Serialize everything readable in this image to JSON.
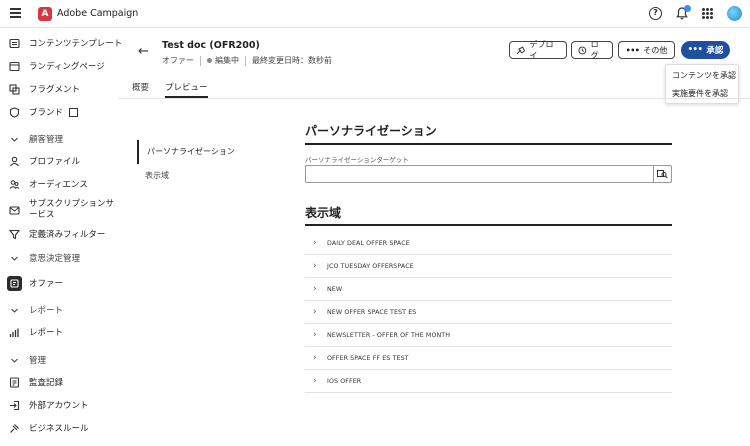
{
  "app": {
    "brand": "Adobe Campaign",
    "logo_letter": "A"
  },
  "sidebar": {
    "items": [
      {
        "label": "コンテンツテンプレート",
        "icon": "template-icon"
      },
      {
        "label": "ランディングページ",
        "icon": "landing-page-icon"
      },
      {
        "label": "フラグメント",
        "icon": "fragment-icon"
      },
      {
        "label": "ブランド",
        "icon": "brand-icon"
      },
      {
        "label": "顧客管理",
        "icon": "chevron-down-icon"
      },
      {
        "label": "プロファイル",
        "icon": "profile-icon"
      },
      {
        "label": "オーディエンス",
        "icon": "audience-icon"
      },
      {
        "label": "サブスクリプションサービス",
        "icon": "subscription-icon"
      },
      {
        "label": "定義済みフィルター",
        "icon": "filter-icon"
      },
      {
        "label": "意思決定管理",
        "icon": "chevron-down-icon"
      },
      {
        "label": "オファー",
        "icon": "offer-icon"
      },
      {
        "label": "レポート",
        "icon": "chevron-down-icon"
      },
      {
        "label": "レポート",
        "icon": "report-icon"
      },
      {
        "label": "管理",
        "icon": "chevron-down-icon"
      },
      {
        "label": "監査記録",
        "icon": "audit-icon"
      },
      {
        "label": "外部アカウント",
        "icon": "external-account-icon"
      },
      {
        "label": "ビジネスルール",
        "icon": "business-rule-icon"
      }
    ]
  },
  "header": {
    "title": "Test doc (OFR200)",
    "type": "オファー",
    "status": "編集中",
    "modified": "最終変更日時：数秒前"
  },
  "toolbar": {
    "deploy": "デプロイ",
    "log": "ログ",
    "more": "その他",
    "approve": "承認"
  },
  "dropdown": {
    "items": [
      "コンテンツを承認",
      "実施要件を承認"
    ]
  },
  "tabs": [
    "概要",
    "プレビュー"
  ],
  "subnav": [
    "パーソナライゼーション",
    "表示域"
  ],
  "personalization": {
    "title": "パーソナライゼーション",
    "field_label": "パーソナライゼーションターゲット",
    "field_value": ""
  },
  "placements": {
    "title": "表示域",
    "items": [
      "DAILY DEAL OFFER SPACE",
      "JCO TUESDAY OFFERSPACE",
      "NEW",
      "NEW OFFER SPACE TEST ES",
      "NEWSLETTER - OFFER OF THE MONTH",
      "OFFER SPACE FF ES TEST",
      "IOS OFFER"
    ]
  },
  "colors": {
    "primary": "#1f4f9f",
    "accent_logo": "#d7373f"
  }
}
